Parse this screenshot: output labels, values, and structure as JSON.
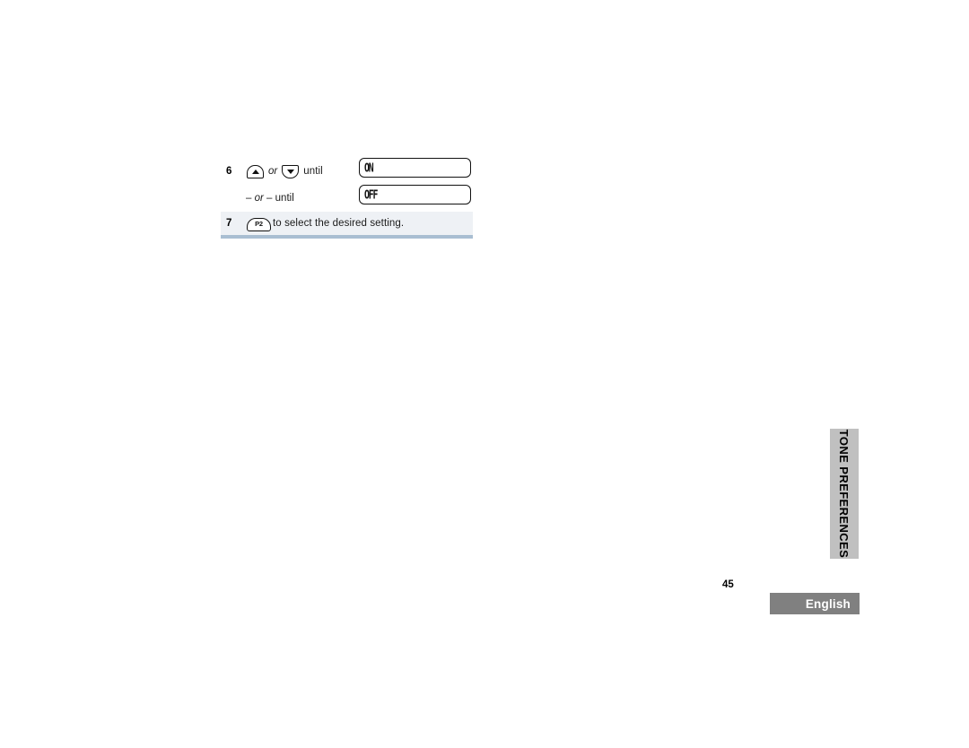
{
  "page": {
    "number": "45",
    "language": "English",
    "section_tab": "TONE PREFERENCES",
    "colors": {
      "shaded_row_bg": "#eef1f5",
      "shaded_row_border": "#a9bed2",
      "side_tab_bg": "#c0c0c0",
      "language_bar_bg": "#808080",
      "ink": "#111111"
    }
  },
  "procedure": {
    "steps": [
      {
        "number": "6",
        "keys": [
          "up-arrow-key",
          "down-arrow-key"
        ],
        "connector": "or",
        "text": "until",
        "display": "ON"
      },
      {
        "number": "",
        "alt_prefix": "–",
        "alt_connector": "or",
        "alt_suffix": "–",
        "text": "until",
        "display": "OFF"
      },
      {
        "number": "7",
        "key_label": "P2",
        "text": "to select the desired setting."
      }
    ]
  }
}
